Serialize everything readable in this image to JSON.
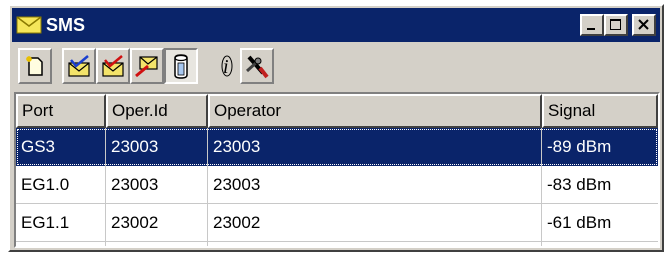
{
  "window": {
    "title": "SMS"
  },
  "columns": [
    "Port",
    "Oper.Id",
    "Operator",
    "Signal"
  ],
  "rows": [
    {
      "port": "GS3",
      "oper_id": "23003",
      "operator": "23003",
      "signal": "-89 dBm",
      "selected": true
    },
    {
      "port": "EG1.0",
      "oper_id": "23003",
      "operator": "23003",
      "signal": "-83 dBm",
      "selected": false
    },
    {
      "port": "EG1.1",
      "oper_id": "23002",
      "operator": "23002",
      "signal": "-61 dBm",
      "selected": false
    }
  ],
  "toolbar": [
    "new-message-icon",
    "inbox-check-icon",
    "outbox-check-icon",
    "delete-message-icon",
    "sim-storage-icon",
    "info-icon",
    "settings-tools-icon"
  ],
  "colors": {
    "titlebar": "#0a246a",
    "selection": "#0a246a",
    "face": "#d4d0c8"
  }
}
